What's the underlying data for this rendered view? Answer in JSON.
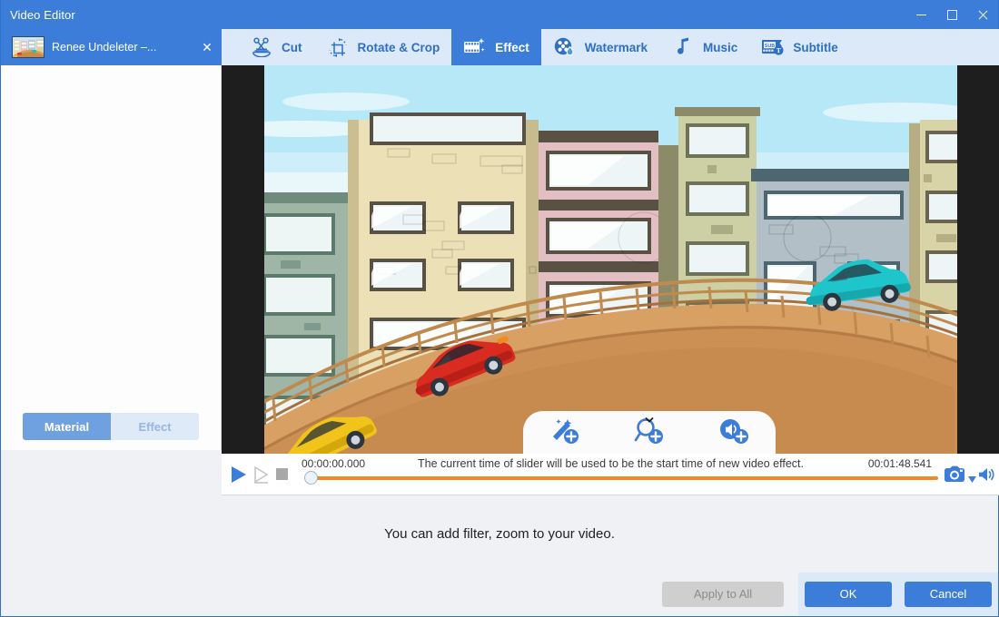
{
  "window": {
    "title": "Video Editor",
    "controls": [
      {
        "name": "minimize",
        "glyph": "minimize-icon"
      },
      {
        "name": "maximize",
        "glyph": "maximize-icon"
      },
      {
        "name": "close",
        "glyph": "close-icon"
      }
    ]
  },
  "document_tab": {
    "label": "Renee Undeleter –...",
    "close_label": "✕",
    "thumbnail": "video-frame-thumbnail"
  },
  "toolbar": {
    "items": [
      {
        "label": "Cut",
        "icon": "scissors-icon",
        "active": false
      },
      {
        "label": "Rotate & Crop",
        "icon": "rotate-crop-icon",
        "active": false
      },
      {
        "label": "Effect",
        "icon": "effect-film-icon",
        "active": true
      },
      {
        "label": "Watermark",
        "icon": "watermark-film-drop-icon",
        "active": false
      },
      {
        "label": "Music",
        "icon": "music-note-icon",
        "active": false
      },
      {
        "label": "Subtitle",
        "icon": "subtitle-icon",
        "active": false
      }
    ]
  },
  "sidebar": {
    "segments": [
      {
        "label": "Material",
        "active": true
      },
      {
        "label": "Effect",
        "active": false
      }
    ]
  },
  "preview": {
    "overlay_buttons": [
      {
        "name": "add-filter",
        "icon": "magic-wand-plus-icon"
      },
      {
        "name": "add-zoom",
        "icon": "magnifier-plus-icon"
      },
      {
        "name": "add-volume",
        "icon": "speaker-plus-icon"
      }
    ],
    "collapse_icon": "chevron-down-icon"
  },
  "transport": {
    "play_icon": "play-icon",
    "step_icon": "step-frame-icon",
    "stop_icon": "stop-icon",
    "current_time": "00:00:00.000",
    "total_time": "00:01:48.541",
    "hint": "The current time of slider will be used to be the start time of new video effect.",
    "snapshot_icon": "camera-icon",
    "snapshot_dropdown_icon": "chevron-down-icon",
    "volume_icon": "speaker-icon",
    "progress_percent": 0
  },
  "bottom": {
    "message": "You can add filter, zoom to your video.",
    "buttons": [
      {
        "label": "Apply to All",
        "enabled": false
      },
      {
        "label": "OK",
        "enabled": true
      },
      {
        "label": "Cancel",
        "enabled": true
      }
    ]
  },
  "colors": {
    "accent": "#3b7dd8",
    "toolbar_bg": "#dce9f8",
    "panel_bg": "#eff1f5",
    "progress": "#f08a1d",
    "disabled_btn": "#cfcfcf"
  }
}
